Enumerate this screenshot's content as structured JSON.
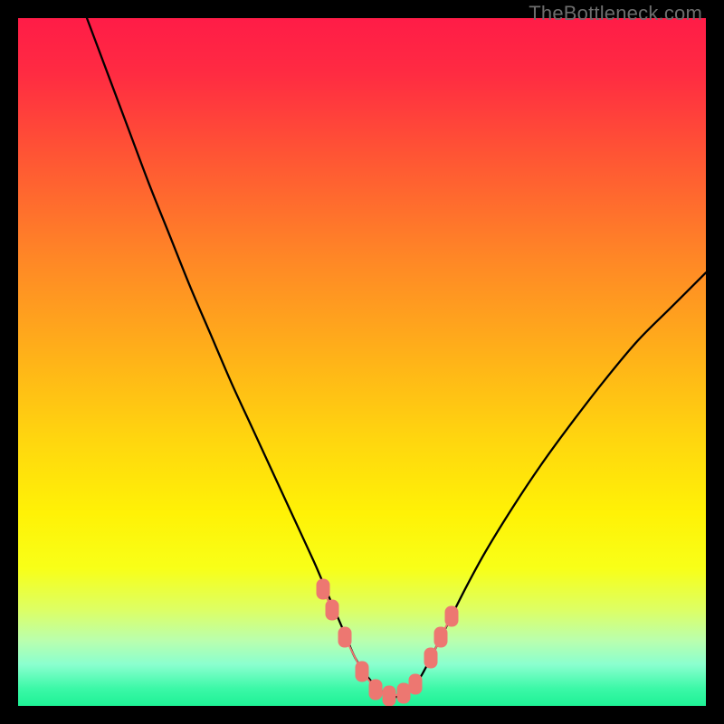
{
  "watermark": "TheBottleneck.com",
  "colors": {
    "frame": "#000000",
    "curve": "#000000",
    "marker": "#ed7771",
    "watermark": "#6d6d6d"
  },
  "chart_data": {
    "type": "line",
    "title": "",
    "xlabel": "",
    "ylabel": "",
    "xlim": [
      0,
      100
    ],
    "ylim": [
      0,
      100
    ],
    "gradient_stops": [
      {
        "pos": 0.0,
        "color": "#ff1c47"
      },
      {
        "pos": 0.08,
        "color": "#ff2b42"
      },
      {
        "pos": 0.2,
        "color": "#ff5534"
      },
      {
        "pos": 0.35,
        "color": "#ff8726"
      },
      {
        "pos": 0.5,
        "color": "#ffb418"
      },
      {
        "pos": 0.62,
        "color": "#ffd80e"
      },
      {
        "pos": 0.72,
        "color": "#fff206"
      },
      {
        "pos": 0.8,
        "color": "#f8ff18"
      },
      {
        "pos": 0.86,
        "color": "#ddff64"
      },
      {
        "pos": 0.905,
        "color": "#baffae"
      },
      {
        "pos": 0.94,
        "color": "#8affcf"
      },
      {
        "pos": 0.975,
        "color": "#3bf8a7"
      },
      {
        "pos": 1.0,
        "color": "#1ef296"
      }
    ],
    "series": [
      {
        "name": "bottleneck-curve",
        "x": [
          10.0,
          13.0,
          16.0,
          19.0,
          22.0,
          25.0,
          28.0,
          31.0,
          34.0,
          37.0,
          40.0,
          43.0,
          44.5,
          46.0,
          47.5,
          49.0,
          51.0,
          53.0,
          55.0,
          57.0,
          58.5,
          60.0,
          62.0,
          65.0,
          68.0,
          72.0,
          76.0,
          80.0,
          85.0,
          90.0,
          95.0,
          100.0
        ],
        "y": [
          100.0,
          92.0,
          84.0,
          76.0,
          68.5,
          61.0,
          54.0,
          47.0,
          40.5,
          34.0,
          27.5,
          21.0,
          17.5,
          14.0,
          10.5,
          7.0,
          4.0,
          2.0,
          1.3,
          2.4,
          4.2,
          7.0,
          11.0,
          17.0,
          22.5,
          29.0,
          35.0,
          40.5,
          47.0,
          53.0,
          58.0,
          63.0
        ]
      }
    ],
    "markers": [
      {
        "x": 44.4,
        "y": 17.0
      },
      {
        "x": 45.7,
        "y": 14.0
      },
      {
        "x": 47.5,
        "y": 10.0
      },
      {
        "x": 50.0,
        "y": 5.0
      },
      {
        "x": 52.0,
        "y": 2.4
      },
      {
        "x": 54.0,
        "y": 1.5
      },
      {
        "x": 56.0,
        "y": 1.8
      },
      {
        "x": 57.8,
        "y": 3.2
      },
      {
        "x": 60.0,
        "y": 7.0
      },
      {
        "x": 61.5,
        "y": 10.0
      },
      {
        "x": 63.0,
        "y": 13.0
      }
    ],
    "marker_segments": [
      {
        "x1": 44.4,
        "y1": 17.0,
        "x2": 45.7,
        "y2": 14.0
      },
      {
        "x1": 47.5,
        "y1": 10.0,
        "x2": 50.0,
        "y2": 5.0
      },
      {
        "x1": 50.0,
        "y1": 5.0,
        "x2": 52.0,
        "y2": 2.4
      },
      {
        "x1": 52.0,
        "y1": 2.4,
        "x2": 54.0,
        "y2": 1.5
      },
      {
        "x1": 54.0,
        "y1": 1.5,
        "x2": 56.0,
        "y2": 1.8
      },
      {
        "x1": 56.0,
        "y1": 1.8,
        "x2": 57.8,
        "y2": 3.2
      },
      {
        "x1": 60.0,
        "y1": 7.0,
        "x2": 61.5,
        "y2": 10.0
      },
      {
        "x1": 61.5,
        "y1": 10.0,
        "x2": 63.0,
        "y2": 13.0
      }
    ]
  }
}
